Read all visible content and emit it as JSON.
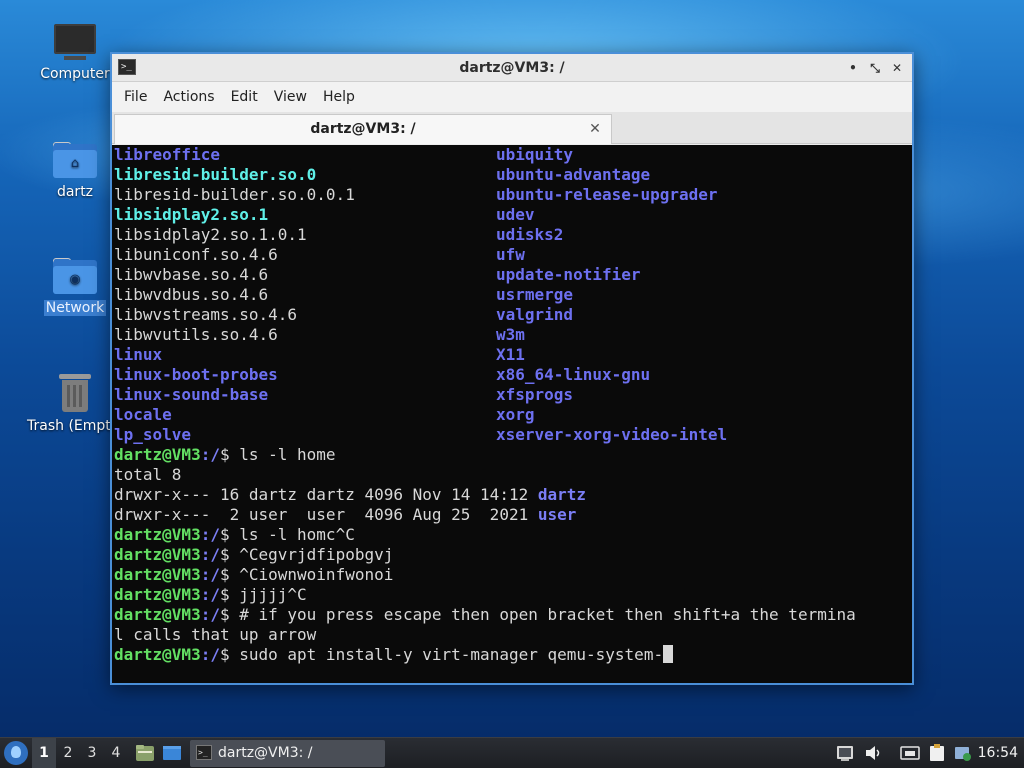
{
  "desktop": {
    "icons": [
      {
        "label": "Computer",
        "icon": "computer-icon"
      },
      {
        "label": "dartz",
        "icon": "home-folder-icon"
      },
      {
        "label": "Network",
        "icon": "network-folder-icon"
      },
      {
        "label": "Trash (Empty)",
        "icon": "trash-icon"
      }
    ]
  },
  "window": {
    "title": "dartz@VM3: /",
    "controls": {
      "minimize": "•",
      "maximize": "⤡",
      "close": "✕"
    },
    "menu": [
      "File",
      "Actions",
      "Edit",
      "View",
      "Help"
    ],
    "tab": {
      "label": "dartz@VM3: /",
      "close": "✕"
    }
  },
  "terminal": {
    "listing": [
      {
        "left": "libreoffice",
        "left_style": "dir",
        "right": "ubiquity",
        "right_style": "dir"
      },
      {
        "left": "libresid-builder.so.0",
        "left_style": "lnk",
        "right": "ubuntu-advantage",
        "right_style": "dir"
      },
      {
        "left": "libresid-builder.so.0.0.1",
        "left_style": "plain",
        "right": "ubuntu-release-upgrader",
        "right_style": "dir"
      },
      {
        "left": "libsidplay2.so.1",
        "left_style": "lnk",
        "right": "udev",
        "right_style": "dir"
      },
      {
        "left": "libsidplay2.so.1.0.1",
        "left_style": "plain",
        "right": "udisks2",
        "right_style": "dir"
      },
      {
        "left": "libuniconf.so.4.6",
        "left_style": "plain",
        "right": "ufw",
        "right_style": "dir"
      },
      {
        "left": "libwvbase.so.4.6",
        "left_style": "plain",
        "right": "update-notifier",
        "right_style": "dir"
      },
      {
        "left": "libwvdbus.so.4.6",
        "left_style": "plain",
        "right": "usrmerge",
        "right_style": "dir"
      },
      {
        "left": "libwvstreams.so.4.6",
        "left_style": "plain",
        "right": "valgrind",
        "right_style": "dir"
      },
      {
        "left": "libwvutils.so.4.6",
        "left_style": "plain",
        "right": "w3m",
        "right_style": "dir"
      },
      {
        "left": "linux",
        "left_style": "dir",
        "right": "X11",
        "right_style": "dir"
      },
      {
        "left": "linux-boot-probes",
        "left_style": "dir",
        "right": "x86_64-linux-gnu",
        "right_style": "dir"
      },
      {
        "left": "linux-sound-base",
        "left_style": "dir",
        "right": "xfsprogs",
        "right_style": "dir"
      },
      {
        "left": "locale",
        "left_style": "dir",
        "right": "xorg",
        "right_style": "dir"
      },
      {
        "left": "lp_solve",
        "left_style": "dir",
        "right": "xserver-xorg-video-intel",
        "right_style": "dir"
      }
    ],
    "prompt_user": "dartz@VM3",
    "prompt_path": ":/",
    "prompt_symbol": "$ ",
    "cmd1": "ls -l home",
    "total": "total 8",
    "ls_rows": [
      {
        "meta": "drwxr-x--- 16 dartz dartz 4096 Nov 14 14:12 ",
        "name": "dartz"
      },
      {
        "meta": "drwxr-x---  2 user  user  4096 Aug 25  2021 ",
        "name": "user"
      }
    ],
    "cmd2": "ls -l homc^C",
    "cmd3": "^Cegvrjdfipobgvj",
    "cmd4": "^Ciownwoinfwonoi",
    "cmd5": "jjjjj^C",
    "cmd6": "# if you press escape then open bracket then shift+a the termina",
    "cmd6_wrap": "l calls that up arrow",
    "cmd7": "sudo apt install-y virt-manager qemu-system-"
  },
  "taskbar": {
    "workspaces": [
      "1",
      "2",
      "3",
      "4"
    ],
    "active_workspace": "1",
    "task_label": "dartz@VM3: /",
    "clock": "16:54"
  }
}
